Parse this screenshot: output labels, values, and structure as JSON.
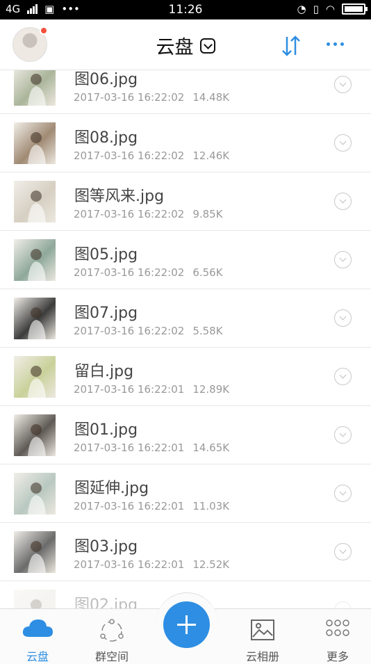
{
  "status_bar": {
    "network": "4G",
    "time": "11:26"
  },
  "header": {
    "title": "云盘"
  },
  "files": [
    {
      "name": "图06.jpg",
      "date": "2017-03-16 16:22:02",
      "size": "14.48K",
      "tone": "#aab59a"
    },
    {
      "name": "图08.jpg",
      "date": "2017-03-16 16:22:02",
      "size": "12.46K",
      "tone": "#a08a74"
    },
    {
      "name": "图等风来.jpg",
      "date": "2017-03-16 16:22:02",
      "size": "9.85K",
      "tone": "#d6cfc2"
    },
    {
      "name": "图05.jpg",
      "date": "2017-03-16 16:22:02",
      "size": "6.56K",
      "tone": "#8ea89a"
    },
    {
      "name": "图07.jpg",
      "date": "2017-03-16 16:22:02",
      "size": "5.58K",
      "tone": "#3c3c3c"
    },
    {
      "name": "留白.jpg",
      "date": "2017-03-16 16:22:01",
      "size": "12.89K",
      "tone": "#c9d19a"
    },
    {
      "name": "图01.jpg",
      "date": "2017-03-16 16:22:01",
      "size": "14.65K",
      "tone": "#5f5a55"
    },
    {
      "name": "图延伸.jpg",
      "date": "2017-03-16 16:22:01",
      "size": "11.03K",
      "tone": "#b8c8c0"
    },
    {
      "name": "图03.jpg",
      "date": "2017-03-16 16:22:01",
      "size": "12.52K",
      "tone": "#6b6b6b"
    },
    {
      "name": "图02.jpg",
      "date": "",
      "size": "",
      "tone": "#e2e0d8"
    }
  ],
  "nav": {
    "cloud": "云盘",
    "group": "群空间",
    "album": "云相册",
    "more": "更多"
  },
  "colors": {
    "accent": "#2d8ee3",
    "badge": "#f2503c"
  }
}
